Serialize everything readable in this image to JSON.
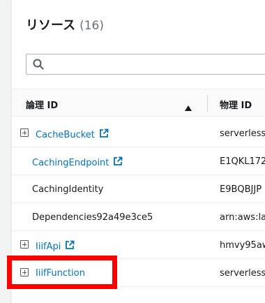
{
  "resources": {
    "title": "リソース",
    "count": "(16)"
  },
  "search": {
    "value": "",
    "placeholder": ""
  },
  "table": {
    "headers": {
      "logical_id": "論理 ID",
      "physical_id": "物理 ID"
    },
    "sort": "ascending",
    "rows": [
      {
        "logical_id": "CacheBucket",
        "physical_id": "serverlessr",
        "expandable": true,
        "link": true,
        "external": true
      },
      {
        "logical_id": "CachingEndpoint",
        "physical_id": "E1QKL172",
        "expandable": false,
        "link": true,
        "external": true
      },
      {
        "logical_id": "CachingIdentity",
        "physical_id": "E9BQBJJP",
        "expandable": false,
        "link": false,
        "external": false
      },
      {
        "logical_id": "Dependencies92a49e3ce5",
        "physical_id": "arn:aws:lan",
        "expandable": false,
        "link": false,
        "external": false
      },
      {
        "logical_id": "IiifApi",
        "physical_id": "hmvy95aw",
        "expandable": true,
        "link": true,
        "external": true
      },
      {
        "logical_id": "IiifFunction",
        "physical_id": "serverlessr",
        "expandable": true,
        "link": true,
        "external": false
      }
    ]
  },
  "colors": {
    "link": "#0073bb",
    "highlight": "#ff0000",
    "panel_bg": "#ffffff",
    "page_bg": "#f2f3f3"
  }
}
